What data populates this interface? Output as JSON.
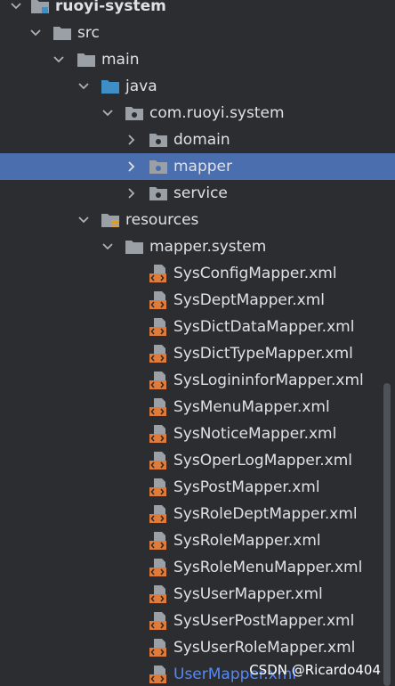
{
  "tree": {
    "root_label": "ruoyi-system",
    "src_label": "src",
    "main_label": "main",
    "java_label": "java",
    "package_label": "com.ruoyi.system",
    "domain_label": "domain",
    "mapper_label": "mapper",
    "service_label": "service",
    "resources_label": "resources",
    "mapper_system_label": "mapper.system",
    "xml_files": [
      "SysConfigMapper.xml",
      "SysDeptMapper.xml",
      "SysDictDataMapper.xml",
      "SysDictTypeMapper.xml",
      "SysLogininforMapper.xml",
      "SysMenuMapper.xml",
      "SysNoticeMapper.xml",
      "SysOperLogMapper.xml",
      "SysPostMapper.xml",
      "SysRoleDeptMapper.xml",
      "SysRoleMapper.xml",
      "SysRoleMenuMapper.xml",
      "SysUserMapper.xml",
      "SysUserPostMapper.xml",
      "SysUserRoleMapper.xml",
      "UserMapper.xml"
    ],
    "selected_item": "mapper"
  },
  "colors": {
    "background": "#2b2d30",
    "selection": "#4b6eaf",
    "text": "#dfe1e5",
    "folder": "#9aa0a6",
    "java_folder": "#3d8fc6",
    "xml_icon": "#e07b39",
    "new_file_text": "#548af7"
  },
  "icons": {
    "root": "module-folder-icon",
    "folder": "folder-icon",
    "source_root": "source-root-folder-icon",
    "package": "package-folder-icon",
    "resources": "resources-folder-icon",
    "xml": "xml-file-icon",
    "expand": "chevron-down-icon",
    "collapse": "chevron-right-icon"
  },
  "watermark": "CSDN @Ricardo404"
}
